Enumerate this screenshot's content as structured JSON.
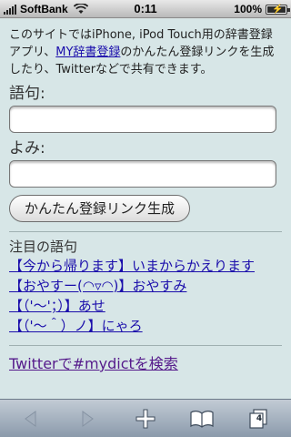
{
  "status_bar": {
    "carrier": "SoftBank",
    "time": "0:11",
    "battery_text": "100%",
    "battery_level": 1.0,
    "signal_icon": "signal-icon",
    "wifi_icon": "wifi-icon",
    "battery_icon": "battery-charging-icon"
  },
  "intro": {
    "text_before": "このサイトではiPhone, iPod Touch用の辞書登録アプリ、",
    "link": "MY辞書登録",
    "text_after": "のかんたん登録リンクを生成したり、Twitterなどで共有できます。"
  },
  "form": {
    "word_label": "語句:",
    "word_value": "",
    "reading_label": "よみ:",
    "reading_value": "",
    "generate_button": "かんたん登録リンク生成"
  },
  "featured": {
    "title": "注目の語句",
    "items": [
      "【今から帰ります】いまからかえります",
      "【おやすー(◠▿◠)】おやすみ",
      "【（'〜'；）】あせ",
      "【（'〜＾）ノ】にゃろ"
    ]
  },
  "twitter_search_link": "Twitterで#mydictを検索",
  "toolbar": {
    "back_icon": "back-arrow-icon",
    "forward_icon": "forward-arrow-icon",
    "add_icon": "plus-icon",
    "bookmarks_icon": "book-icon",
    "pages_icon": "pages-icon",
    "pages_count": "4"
  }
}
